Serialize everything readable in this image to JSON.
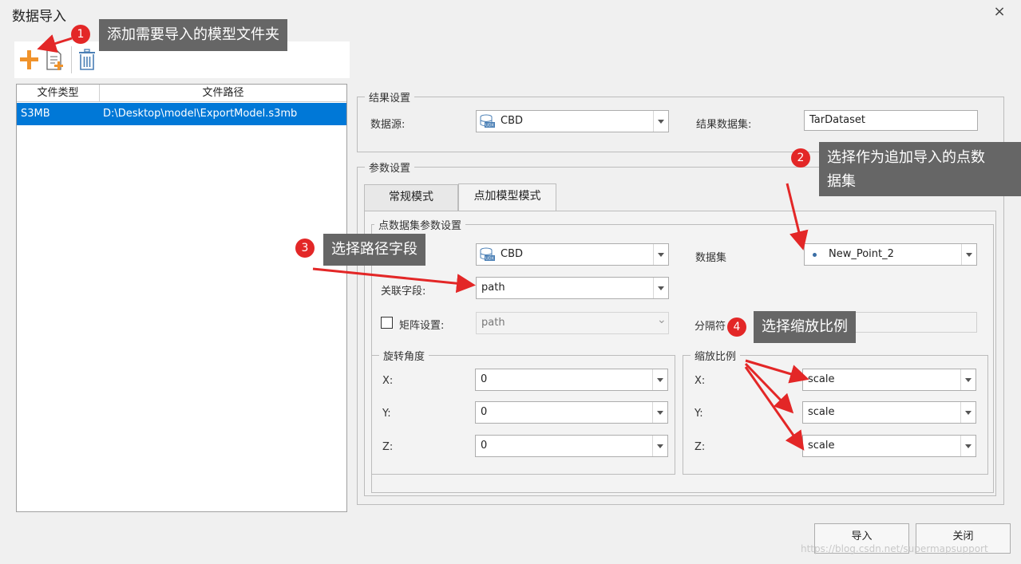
{
  "window": {
    "title": "数据导入",
    "close_glyph": "×"
  },
  "file_table": {
    "headers": [
      "文件类型",
      "文件路径"
    ],
    "rows": [
      {
        "type": "S3MB",
        "path": "D:\\Desktop\\model\\ExportModel.s3mb"
      }
    ]
  },
  "result_settings": {
    "legend": "结果设置",
    "datasource_label": "数据源:",
    "datasource_value": "CBD",
    "result_dataset_label": "结果数据集:",
    "result_dataset_value": "TarDataset"
  },
  "param_settings": {
    "legend": "参数设置",
    "tabs": [
      {
        "label": "常规模式"
      },
      {
        "label": "点加模型模式"
      }
    ],
    "point_group_legend": "点数据集参数设置",
    "datasource_value": "CBD",
    "dataset_label": "数据集",
    "dataset_value": "New_Point_2",
    "link_field_label": "关联字段:",
    "link_field_value": "path",
    "matrix_label": "矩阵设置:",
    "matrix_value": "path",
    "separator_label": "分隔符",
    "rotation": {
      "legend": "旋转角度",
      "rows": [
        {
          "label": "X:",
          "value": "0"
        },
        {
          "label": "Y:",
          "value": "0"
        },
        {
          "label": "Z:",
          "value": "0"
        }
      ]
    },
    "scale": {
      "legend": "缩放比例",
      "rows": [
        {
          "label": "X:",
          "value": "scale"
        },
        {
          "label": "Y:",
          "value": "scale"
        },
        {
          "label": "Z:",
          "value": "scale"
        }
      ]
    }
  },
  "buttons": {
    "import": "导入",
    "close": "关闭"
  },
  "annotations": [
    {
      "num": "1",
      "text": "添加需要导入的模型文件夹"
    },
    {
      "num": "2",
      "text_line1": "选择作为追加导入的点数",
      "text_line2": "据集"
    },
    {
      "num": "3",
      "text": "选择路径字段"
    },
    {
      "num": "4",
      "text": "选择缩放比例"
    }
  ],
  "watermark": "https://blog.csdn.net/supermapsupport",
  "colors": {
    "selection": "#0078d7",
    "callout": "#666666",
    "badge": "#e32727",
    "add_icon": "#f0932b"
  }
}
